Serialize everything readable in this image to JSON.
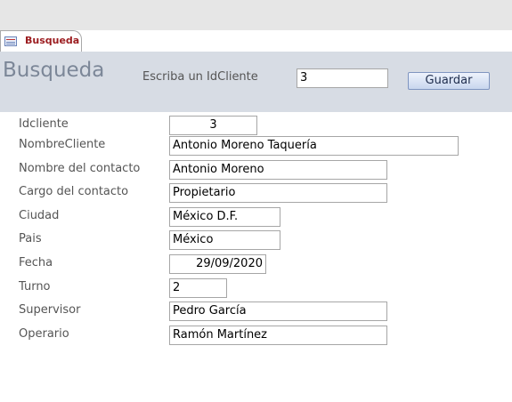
{
  "tab": {
    "label": "Busqueda"
  },
  "header": {
    "title": "Busqueda",
    "prompt_label": "Escriba un IdCliente",
    "id_value": "3",
    "save_label": "Guardar"
  },
  "fields": [
    {
      "label": "Idcliente",
      "value": "3"
    },
    {
      "label": "NombreCliente",
      "value": "Antonio Moreno Taquería"
    },
    {
      "label": "Nombre del contacto",
      "value": "Antonio Moreno"
    },
    {
      "label": "Cargo del contacto",
      "value": "Propietario"
    },
    {
      "label": "Ciudad",
      "value": "México D.F."
    },
    {
      "label": "Pais",
      "value": "México"
    },
    {
      "label": "Fecha",
      "value": "29/09/2020"
    },
    {
      "label": "Turno",
      "value": "2"
    },
    {
      "label": "Supervisor",
      "value": "Pedro García"
    },
    {
      "label": "Operario",
      "value": "Ramón Martínez"
    }
  ]
}
